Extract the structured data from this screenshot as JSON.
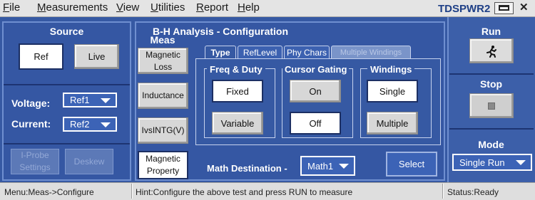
{
  "menu": {
    "items": [
      {
        "first": "F",
        "rest": "ile"
      },
      {
        "first": "M",
        "rest": "easurements"
      },
      {
        "first": "V",
        "rest": "iew"
      },
      {
        "first": "U",
        "rest": "tilities"
      },
      {
        "first": "R",
        "rest": "eport"
      },
      {
        "first": "H",
        "rest": "elp"
      }
    ],
    "brand": "TDSPWR2",
    "close_glyph": "✕"
  },
  "source": {
    "title": "Source",
    "ref_label": "Ref",
    "live_label": "Live",
    "voltage_label": "Voltage:",
    "voltage_value": "Ref1",
    "current_label": "Current:",
    "current_value": "Ref2",
    "iprobe_label": "I-Probe Settings",
    "deskew_label": "Deskew"
  },
  "meas": {
    "header": "Meas",
    "buttons": [
      "Magnetic Loss",
      "Inductance",
      "IvsINTG(V)",
      "Magnetic Property"
    ]
  },
  "config": {
    "title": "B-H Analysis - Configuration",
    "tabs": [
      "Type",
      "RefLevel",
      "Phy Chars",
      "Multiple Windings"
    ],
    "freq_duty": {
      "title": "Freq & Duty",
      "options": [
        "Fixed",
        "Variable"
      ]
    },
    "cursor_gating": {
      "title": "Cursor Gating",
      "options": [
        "On",
        "Off"
      ]
    },
    "windings": {
      "title": "Windings",
      "options": [
        "Single",
        "Multiple"
      ]
    },
    "math_dest_label": "Math Destination -",
    "math_dest_value": "Math1",
    "select_label": "Select"
  },
  "run_panel": {
    "run_label": "Run",
    "run_icon": "running-man-icon",
    "stop_label": "Stop",
    "stop_icon": "stop-square-icon",
    "mode_label": "Mode",
    "mode_value": "Single Run"
  },
  "status": {
    "menu_path": "Menu:Meas->Configure",
    "hint": "Hint:Configure the above test and press RUN to measure",
    "state": "Status:Ready"
  },
  "colors": {
    "panel_blue": "#3659a3",
    "border_blue": "#6f8fd0",
    "brand_blue": "#1e3f86"
  }
}
